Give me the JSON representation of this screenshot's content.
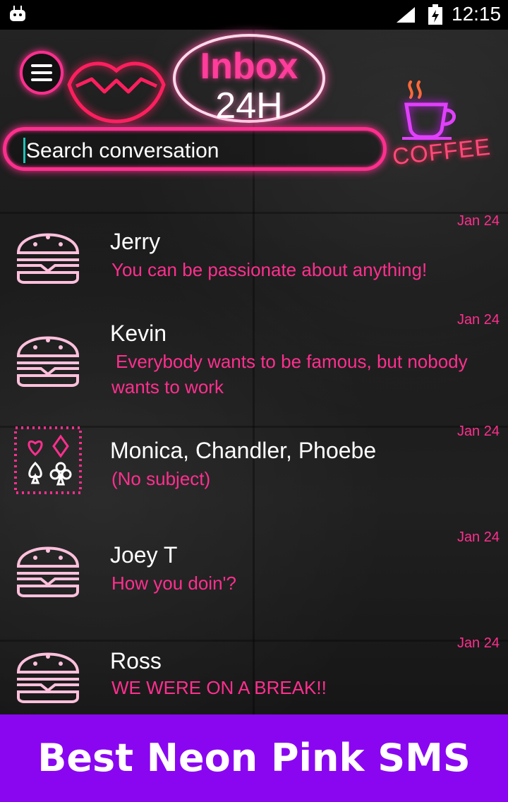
{
  "status_bar": {
    "time": "12:15"
  },
  "header": {
    "sign_title": "Inbox",
    "sign_subtitle": "24H",
    "coffee_label": "COFFEE"
  },
  "search": {
    "placeholder": "Search conversation"
  },
  "conversations": [
    {
      "name": "Jerry",
      "message": "You can be passionate about anything!",
      "date": "Jan 24",
      "avatar": "burger-icon"
    },
    {
      "name": "Kevin",
      "message": "Everybody wants to be famous, but nobody wants to work",
      "date": "Jan 24",
      "avatar": "burger-icon"
    },
    {
      "name": "Monica, Chandler, Phoebe",
      "message": "(No subject)",
      "date": "Jan 24",
      "avatar": "card-suits-icon"
    },
    {
      "name": "Joey T",
      "message": "How you doin'?",
      "date": "Jan 24",
      "avatar": "burger-icon"
    },
    {
      "name": "Ross",
      "message": "WE WERE ON A BREAK!!",
      "date": "Jan 24",
      "avatar": "burger-icon"
    }
  ],
  "banner": {
    "text": "Best Neon Pink SMS"
  },
  "colors": {
    "neon_pink": "#ff2f8e",
    "banner_purple": "#8a06f0"
  }
}
